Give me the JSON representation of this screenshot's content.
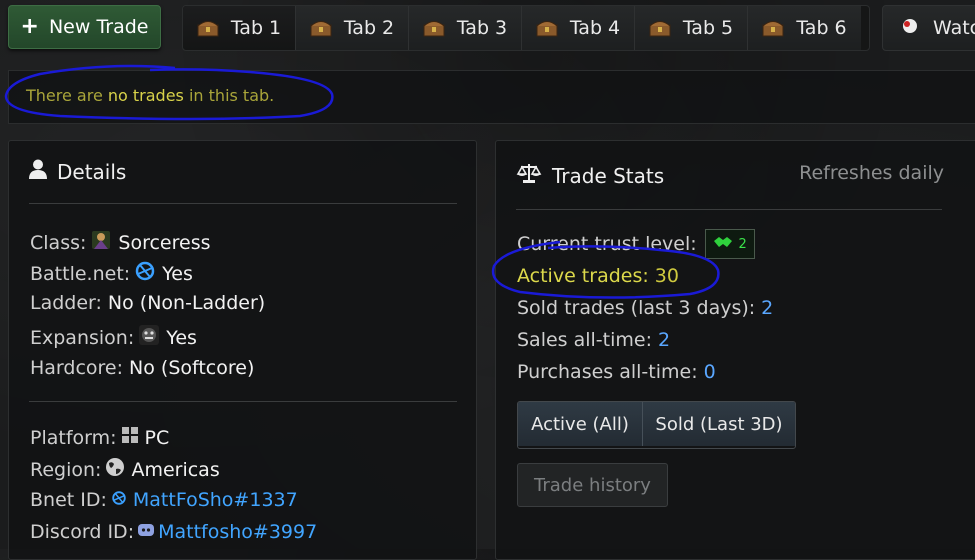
{
  "toolbar": {
    "new_trade_label": "New Trade",
    "tabs": [
      "Tab 1",
      "Tab 2",
      "Tab 3",
      "Tab 4",
      "Tab 5",
      "Tab 6"
    ],
    "watch_label": "Watc"
  },
  "notice": {
    "prefix": "There are ",
    "emphasis": "no trades",
    "suffix": " in this tab."
  },
  "details": {
    "title": "Details",
    "class_label": "Class:",
    "class_value": "Sorceress",
    "battlenet_label": "Battle.net:",
    "battlenet_value": "Yes",
    "ladder_label": "Ladder:",
    "ladder_value": "No (Non-Ladder)",
    "expansion_label": "Expansion:",
    "expansion_value": "Yes",
    "hardcore_label": "Hardcore:",
    "hardcore_value": "No (Softcore)",
    "platform_label": "Platform:",
    "platform_value": "PC",
    "region_label": "Region:",
    "region_value": "Americas",
    "bnet_id_label": "Bnet ID:",
    "bnet_id_value": "MattFoSho#1337",
    "discord_id_label": "Discord ID:",
    "discord_id_value": "Mattfosho#3997"
  },
  "stats": {
    "title": "Trade Stats",
    "refresh_note": "Refreshes daily",
    "trust_label": "Current trust level:",
    "trust_value": "2",
    "active_label": "Active trades:",
    "active_value": "30",
    "sold_label": "Sold trades (last 3 days):",
    "sold_value": "2",
    "sales_label": "Sales all-time:",
    "sales_value": "2",
    "purchases_label": "Purchases all-time:",
    "purchases_value": "0",
    "btn_active_all": "Active (All)",
    "btn_sold_last": "Sold (Last 3D)",
    "btn_history": "Trade history"
  },
  "colors": {
    "accent_green": "#2f5a35",
    "notice_text": "#a9a53a",
    "link_blue": "#41a5ff",
    "annotation_blue": "#1a1ad6"
  },
  "icons": [
    "plus-icon",
    "chest-icon",
    "eye-icon",
    "user-icon",
    "scale-icon",
    "sorceress-icon",
    "battlenet-icon",
    "expansion-icon",
    "windows-icon",
    "globe-icon",
    "discord-icon",
    "handshake-icon"
  ]
}
